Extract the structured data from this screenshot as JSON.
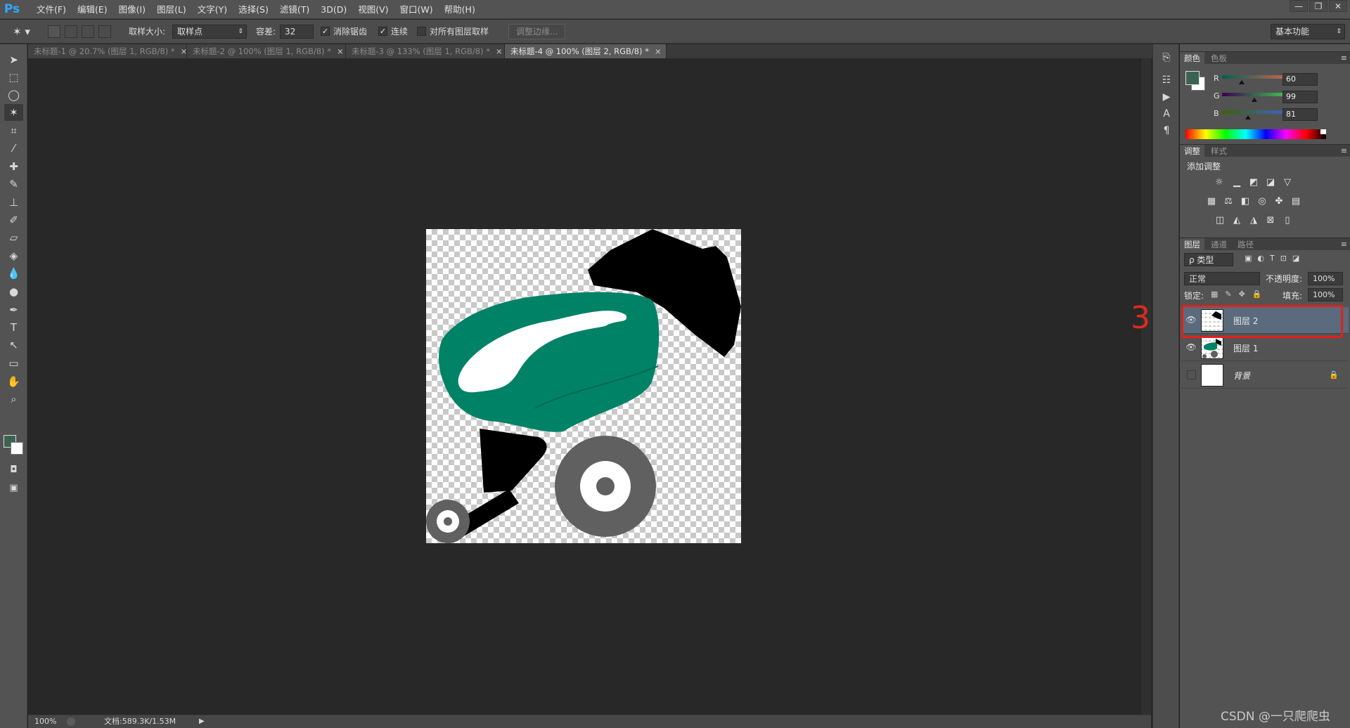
{
  "app": {
    "logo": "Ps"
  },
  "menu": [
    "文件(F)",
    "编辑(E)",
    "图像(I)",
    "图层(L)",
    "文字(Y)",
    "选择(S)",
    "滤镜(T)",
    "3D(D)",
    "视图(V)",
    "窗口(W)",
    "帮助(H)"
  ],
  "window_controls": {
    "minimize": "—",
    "restore": "❐",
    "close": "✕"
  },
  "options": {
    "tool_icon": "magic-wand-icon",
    "sample_size_label": "取样大小:",
    "sample_size_value": "取样点",
    "tolerance_label": "容差:",
    "tolerance_value": "32",
    "antialias_label": "消除锯齿",
    "antialias_checked": true,
    "contiguous_label": "连续",
    "contiguous_checked": true,
    "all_layers_label": "对所有图层取样",
    "all_layers_checked": false,
    "refine_edge": "调整边缘...",
    "workspace": "基本功能"
  },
  "tabs": [
    {
      "label": "未标题-1 @ 20.7% (图层 1, RGB/8) *",
      "active": false
    },
    {
      "label": "未标题-2 @ 100% (图层 1, RGB/8) *",
      "active": false
    },
    {
      "label": "未标题-3 @ 133% (图层 1, RGB/8) *",
      "active": false
    },
    {
      "label": "未标题-4 @ 100% (图层 2, RGB/8) *",
      "active": true
    }
  ],
  "tab_close": "×",
  "status": {
    "zoom": "100%",
    "doc_info": "文档:589.3K/1.53M"
  },
  "color_panel": {
    "tabs": [
      "颜色",
      "色板"
    ],
    "channels": [
      {
        "label": "R",
        "value": "60"
      },
      {
        "label": "G",
        "value": "99"
      },
      {
        "label": "B",
        "value": "81"
      }
    ],
    "foreground": "#3c6351",
    "background": "#ffffff"
  },
  "adjust_panel": {
    "tabs": [
      "调整",
      "样式"
    ],
    "add_label": "添加调整"
  },
  "layers_panel": {
    "tabs": [
      "图层",
      "通道",
      "路径"
    ],
    "filter_kind": "ρ 类型",
    "blend_mode": "正常",
    "opacity_label": "不透明度:",
    "opacity_value": "100%",
    "lock_label": "锁定:",
    "fill_label": "填充:",
    "fill_value": "100%",
    "layers": [
      {
        "name": "图层 2",
        "visible": true,
        "selected": true
      },
      {
        "name": "图层 1",
        "visible": true,
        "selected": false
      },
      {
        "name": "背景",
        "visible": false,
        "selected": false,
        "locked": true
      }
    ]
  },
  "annotation": {
    "label": "3"
  },
  "watermark": "CSDN @一只爬爬虫",
  "colors": {
    "green": "#008266",
    "gray": "#606060",
    "black": "#000000",
    "red_annotation": "#e3211b"
  }
}
